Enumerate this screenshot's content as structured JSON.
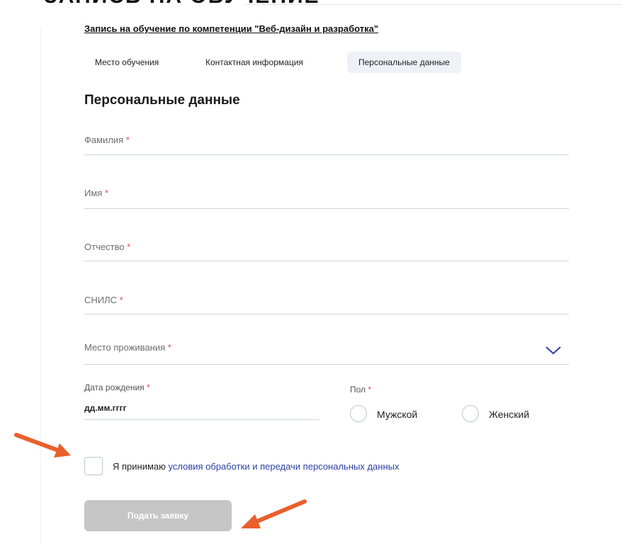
{
  "page": {
    "heading": "ЗАПИСЬ НА ОБУЧЕНИЕ",
    "breadcrumb": "Запись на обучение по компетенции \"Веб-дизайн и разработка\""
  },
  "tabs": [
    {
      "label": "Место обучения",
      "active": false
    },
    {
      "label": "Контактная информация",
      "active": false
    },
    {
      "label": "Персональные данные",
      "active": true
    }
  ],
  "form": {
    "title": "Персональные данные",
    "required_mark": "*",
    "fields": {
      "last_name": {
        "label": "Фамилия",
        "value": ""
      },
      "first_name": {
        "label": "Имя",
        "value": ""
      },
      "patronymic": {
        "label": "Отчество",
        "value": ""
      },
      "snils": {
        "label": "СНИЛС",
        "value": ""
      },
      "residence": {
        "label": "Место проживания",
        "value": "",
        "icon": "chevron-down-icon"
      }
    },
    "birth_date": {
      "label": "Дата рождения",
      "placeholder": "дд.мм.гггг"
    },
    "gender": {
      "label": "Пол",
      "options": [
        {
          "label": "Мужской",
          "selected": false
        },
        {
          "label": "Женский",
          "selected": false
        }
      ]
    },
    "consent": {
      "checked": false,
      "text": "Я принимаю",
      "link": "условия обработки и передачи персональных данных"
    },
    "submit_label": "Подать заявку"
  },
  "colors": {
    "accent_link": "#2c3fa3",
    "required": "#e34b4b",
    "annotation_arrow": "#e8602c",
    "disabled_button": "#c6c6c6",
    "active_tab_bg": "#eef1f6"
  }
}
